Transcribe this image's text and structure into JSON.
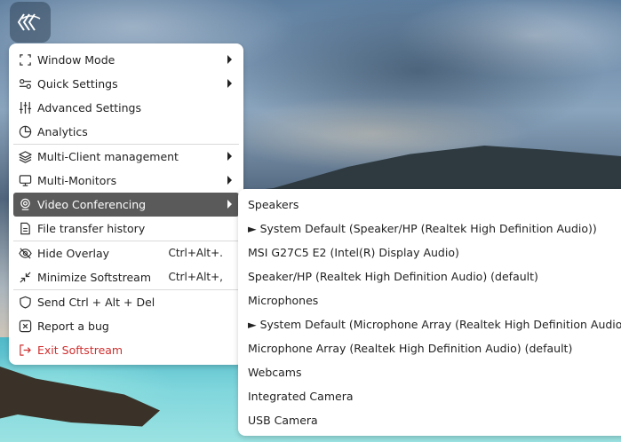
{
  "menu": {
    "items": [
      {
        "label": "Window Mode",
        "icon": "window-mode-icon",
        "submenu": true
      },
      {
        "label": "Quick Settings",
        "icon": "quick-settings-icon",
        "submenu": true
      },
      {
        "label": "Advanced Settings",
        "icon": "sliders-icon",
        "submenu": false
      },
      {
        "label": "Analytics",
        "icon": "pie-chart-icon",
        "submenu": false
      },
      {
        "label": "Multi-Client management",
        "icon": "layers-icon",
        "submenu": true
      },
      {
        "label": "Multi-Monitors",
        "icon": "monitor-icon",
        "submenu": true
      },
      {
        "label": "Video Conferencing",
        "icon": "webcam-icon",
        "submenu": true,
        "active": true
      },
      {
        "label": "File transfer history",
        "icon": "file-icon",
        "submenu": false
      },
      {
        "label": "Hide Overlay",
        "icon": "eye-off-icon",
        "shortcut": "Ctrl+Alt+."
      },
      {
        "label": "Minimize Softstream",
        "icon": "minimize-icon",
        "shortcut": "Ctrl+Alt+,"
      },
      {
        "label": "Send Ctrl + Alt + Del",
        "icon": "shield-icon"
      },
      {
        "label": "Report a bug",
        "icon": "bug-icon"
      },
      {
        "label": "Exit Softstream",
        "icon": "exit-icon",
        "danger": true
      }
    ]
  },
  "submenu": {
    "items": [
      "Speakers",
      "► System Default (Speaker/HP (Realtek High Definition Audio))",
      "MSI G27C5 E2 (Intel(R) Display Audio)",
      "Speaker/HP (Realtek High Definition Audio) (default)",
      "Microphones",
      "► System Default (Microphone Array (Realtek High Definition Audio))",
      "Microphone Array (Realtek High Definition Audio) (default)",
      "Webcams",
      "Integrated Camera",
      "USB Camera"
    ]
  },
  "colors": {
    "menu_bg": "#ffffff",
    "active_bg": "#5a5a5a",
    "danger": "#d03030"
  }
}
